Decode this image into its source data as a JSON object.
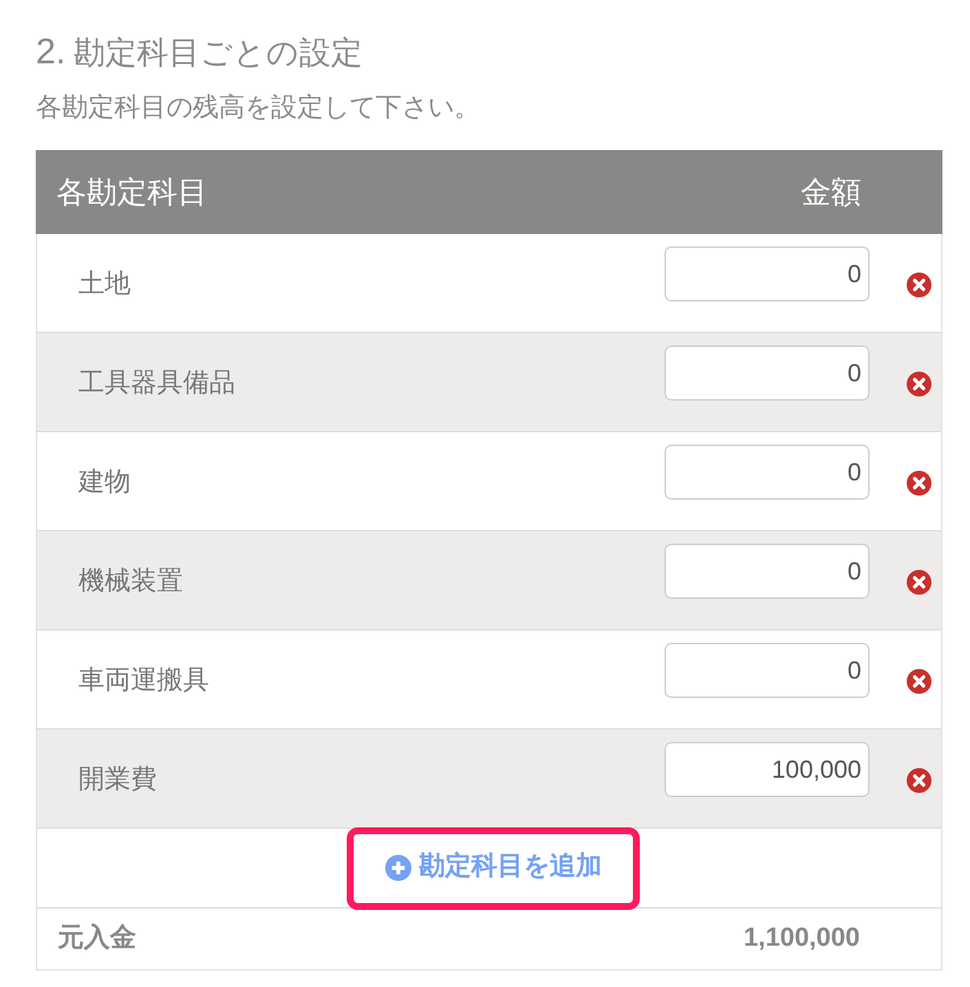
{
  "section": {
    "number": "2.",
    "title": "勘定科目ごとの設定",
    "description": "各勘定科目の残高を設定して下さい。"
  },
  "table": {
    "columns": [
      "各勘定科目",
      "金額"
    ],
    "rows": [
      {
        "account": "土地",
        "amount": "0"
      },
      {
        "account": "工具器具備品",
        "amount": "0"
      },
      {
        "account": "建物",
        "amount": "0"
      },
      {
        "account": "機械装置",
        "amount": "0"
      },
      {
        "account": "車両運搬具",
        "amount": "0"
      },
      {
        "account": "開業費",
        "amount": "100,000"
      }
    ],
    "add_button": {
      "label": "勘定科目を追加",
      "highlighted": true
    },
    "total": {
      "label": "元入金",
      "amount": "1,100,000"
    }
  }
}
